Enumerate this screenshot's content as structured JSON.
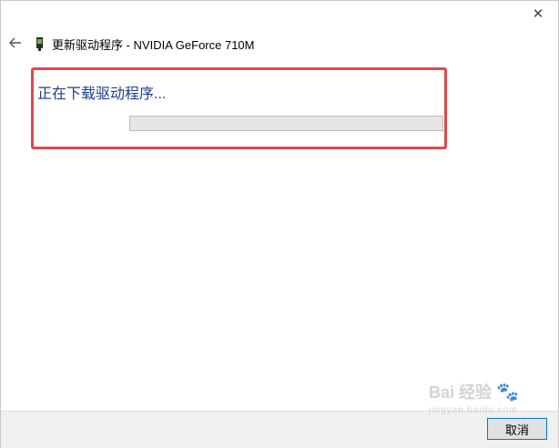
{
  "window": {
    "close_glyph": "✕",
    "back_glyph": "←"
  },
  "header": {
    "device_icon": "graphics-card-icon",
    "title": "更新驱动程序 - NVIDIA GeForce 710M"
  },
  "main": {
    "status_text": "正在下载驱动程序...",
    "progress_fraction": 0
  },
  "footer": {
    "cancel_label": "取消"
  },
  "watermark": {
    "text": "Bai 经验",
    "sub": "jingyan.baidu.com"
  },
  "colors": {
    "accent": "#0078d7",
    "status_text": "#1f3d8f",
    "highlight": "#e0474c"
  }
}
